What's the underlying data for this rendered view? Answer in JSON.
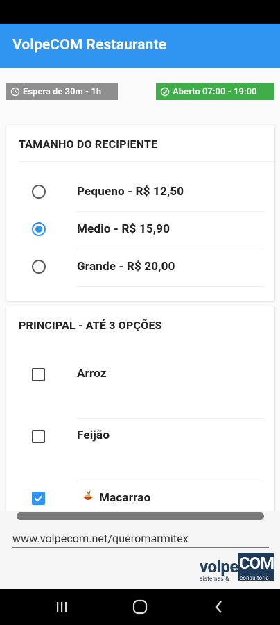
{
  "app": {
    "title": "VolpeCOM Restaurante"
  },
  "badges": {
    "wait": {
      "text": "Espera de 30m - 1h",
      "color": "#8f8f8f",
      "icon": "clock-icon"
    },
    "open": {
      "text": "Aberto 07:00 - 19:00",
      "color": "#3fae49",
      "icon": "check-circle-icon"
    }
  },
  "container_section": {
    "title": "TAMANHO DO RECIPIENTE",
    "options": [
      {
        "label": "Pequeno - R$ 12,50",
        "selected": false
      },
      {
        "label": "Medio - R$ 15,90",
        "selected": true
      },
      {
        "label": "Grande - R$ 20,00",
        "selected": false
      }
    ]
  },
  "main_section": {
    "title": "PRINCIPAL - ATÉ 3 OPÇÕES",
    "options": [
      {
        "label": "Arroz",
        "checked": false
      },
      {
        "label": "Feijão",
        "checked": false
      },
      {
        "label": "Macarrao",
        "checked": true,
        "icon": "pasta-icon"
      }
    ]
  },
  "ad": {
    "url": "www.volpecom.net/queromarmitex",
    "logo_left": "volpe",
    "logo_right": "COM",
    "logo_sub_left": "sistemas &",
    "logo_sub_right": "consultoria"
  },
  "colors": {
    "accent": "#2f95f0",
    "app_bar": "#2f95f0"
  },
  "nav": {
    "icons": [
      "recent-apps-icon",
      "home-icon",
      "back-icon"
    ]
  }
}
